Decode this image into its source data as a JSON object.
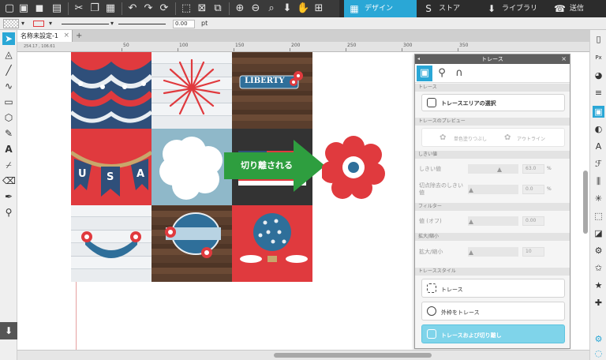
{
  "toolbar": {
    "icons": [
      "new-file",
      "open-file",
      "save",
      "print",
      "cut",
      "copy",
      "paste",
      "undo",
      "redo",
      "refresh",
      "select-all",
      "deselect",
      "replicate",
      "zoom-in",
      "zoom-out",
      "zoom-fit",
      "move-down",
      "pan",
      "add-page"
    ],
    "nav_tabs": [
      {
        "label": "デザイン",
        "icon": "grid-icon",
        "active": true
      },
      {
        "label": "ストア",
        "icon": "store-icon",
        "active": false
      },
      {
        "label": "ライブラリ",
        "icon": "library-icon",
        "active": false
      },
      {
        "label": "送信",
        "icon": "send-icon",
        "active": false
      }
    ]
  },
  "propbar": {
    "line_width": "0.00",
    "unit": "pt"
  },
  "document": {
    "tab_title": "名称未設定-1",
    "tab_close": "×",
    "tab_add": "+"
  },
  "ruler": {
    "coords": "254.17 ,  106.61",
    "labels": [
      "50",
      "100",
      "150",
      "200",
      "250",
      "300",
      "350"
    ]
  },
  "callout": {
    "text": "切り離される"
  },
  "trace_panel": {
    "title": "トレース",
    "close": "×",
    "section_trace": "トレース",
    "select_area": "トレースエリアの選択",
    "section_preview": "トレースのプレビュー",
    "fill_label": "単色塗りつぶし",
    "outline_label": "アウトライン",
    "section_threshold": "しきい値",
    "threshold_label": "しきい値",
    "threshold_value": "63.0",
    "threshold_unit": "%",
    "highpass_label": "切点除去のしきい値",
    "highpass_value": "0.0",
    "highpass_unit": "%",
    "section_filter": "フィルター",
    "filter_label": "値 (オフ)",
    "filter_value": "0.00",
    "section_scale": "拡大/縮小",
    "scale_label": "拡大/縮小",
    "scale_value": "10",
    "section_style": "トレーススタイル",
    "style_trace": "トレース",
    "style_outer": "外枠をトレース",
    "style_detach": "トレースおよび切り離し"
  },
  "colors": {
    "accent": "#2aa7d6",
    "red": "#e03a3e",
    "navy": "#2f4f7a",
    "green_arrow": "#2e9e3f"
  },
  "grid_text": {
    "usa": [
      "U",
      "S",
      "A"
    ],
    "liberty": "LIBERTY"
  }
}
